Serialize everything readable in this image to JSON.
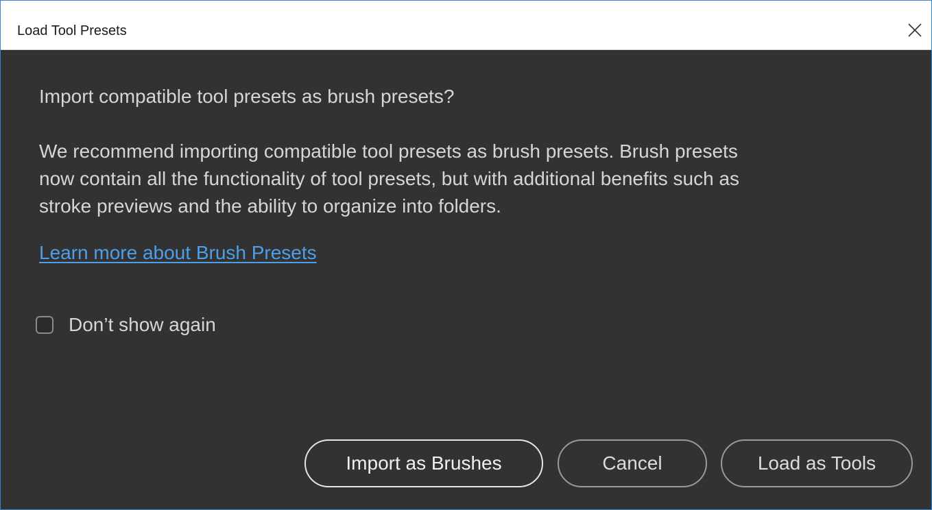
{
  "window": {
    "title": "Load Tool Presets",
    "close_icon": "close-icon"
  },
  "dialog": {
    "question": "Import compatible tool presets as brush presets?",
    "description_lines": [
      "We recommend importing compatible tool presets as brush presets. Brush presets",
      "now contain all the functionality of tool presets, but with additional benefits such as",
      "stroke previews and the ability to organize into folders."
    ],
    "link_text": "Learn more about Brush Presets",
    "checkbox": {
      "label": "Don’t show again",
      "checked": false
    }
  },
  "buttons": {
    "import_label": "Import as Brushes",
    "cancel_label": "Cancel",
    "load_label": "Load as Tools"
  },
  "colors": {
    "background": "#323232",
    "text": "#d6d6d6",
    "link": "#4c9fe8",
    "titlebar": "#ffffff"
  }
}
